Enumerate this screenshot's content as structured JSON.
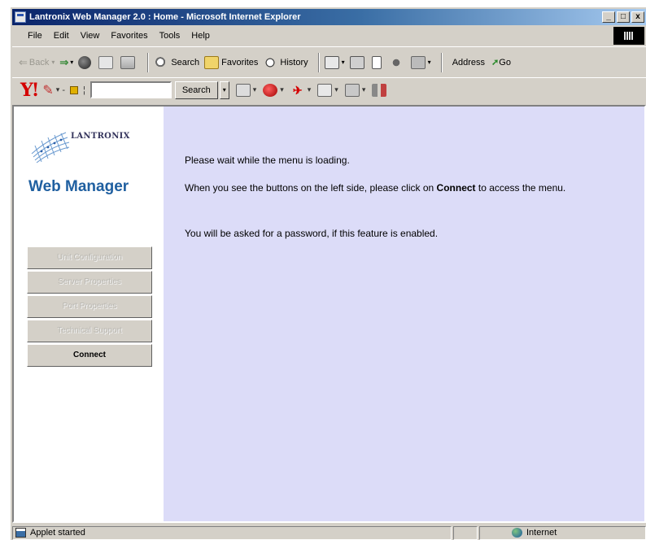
{
  "window": {
    "title": "Lantronix Web Manager 2.0 : Home - Microsoft Internet Explorer",
    "controls": {
      "minimize": "_",
      "maximize": "□",
      "close": "x"
    }
  },
  "menubar": {
    "items": [
      "File",
      "Edit",
      "View",
      "Favorites",
      "Tools",
      "Help"
    ]
  },
  "toolbar": {
    "back_label": "Back",
    "search_label": "Search",
    "favorites_label": "Favorites",
    "history_label": "History",
    "address_label": "Address",
    "go_label": "Go"
  },
  "ytoolbar": {
    "logo": "Y!",
    "search_button": "Search",
    "search_value": ""
  },
  "left_frame": {
    "brand_text": "LANTRONIX",
    "app_title": "Web Manager",
    "buttons": [
      {
        "label": "Unit Configuration",
        "enabled": false
      },
      {
        "label": "Server Properties",
        "enabled": false
      },
      {
        "label": "Port Properties",
        "enabled": false
      },
      {
        "label": "Technical Support",
        "enabled": false
      },
      {
        "label": "Connect",
        "enabled": true
      }
    ]
  },
  "right_frame": {
    "line1": "Please wait while the menu is loading.",
    "line2_pre": "When you see the buttons on the left side, please click on ",
    "line2_bold": "Connect",
    "line2_post": " to access the menu.",
    "line3": "You will be asked for a password, if this feature is enabled."
  },
  "statusbar": {
    "status_text": "Applet started",
    "zone_text": "Internet"
  },
  "colors": {
    "right_frame_bg": "#dcdcf8",
    "brand_blue": "#1f5fa0",
    "title_bar": "#0a246a"
  }
}
